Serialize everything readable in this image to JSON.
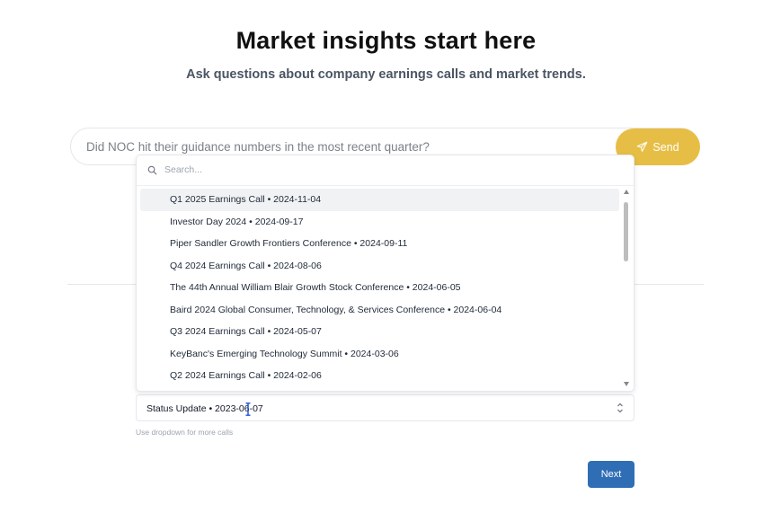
{
  "header": {
    "title": "Market insights start here",
    "subtitle": "Ask questions about company earnings calls and market trends."
  },
  "query": {
    "text": "Did NOC hit their guidance numbers in the most recent quarter?"
  },
  "send_button": {
    "label": "Send",
    "icon": "send-icon"
  },
  "dropdown": {
    "search_placeholder": "Search...",
    "options": [
      "Q1 2025 Earnings Call • 2024-11-04",
      "Investor Day 2024 • 2024-09-17",
      "Piper Sandler Growth Frontiers Conference • 2024-09-11",
      "Q4 2024 Earnings Call • 2024-08-06",
      "The 44th Annual William Blair Growth Stock Conference • 2024-06-05",
      "Baird 2024 Global Consumer, Technology, & Services Conference • 2024-06-04",
      "Q3 2024 Earnings Call • 2024-05-07",
      "KeyBanc's Emerging Technology Summit • 2024-03-06",
      "Q2 2024 Earnings Call • 2024-02-06"
    ],
    "highlighted_index": 0
  },
  "call_select": {
    "value": "Status Update • 2023-06-07",
    "hint": "Use dropdown for more calls"
  },
  "next_button": {
    "label": "Next"
  },
  "colors": {
    "send_button": "#e7be45",
    "next_button": "#2f6eb5",
    "highlight_row": "#f1f2f4"
  }
}
